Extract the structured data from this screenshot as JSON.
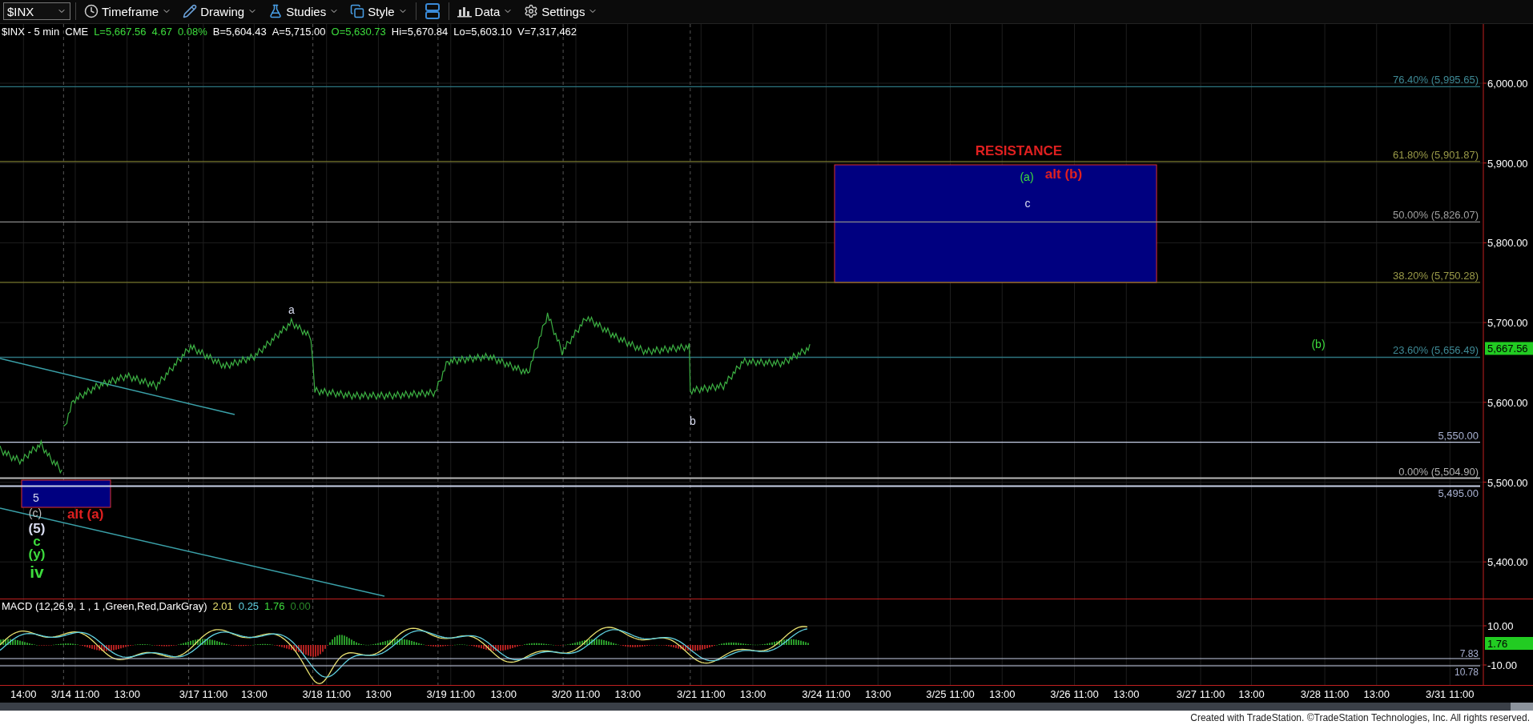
{
  "toolbar": {
    "symbol": "$INX",
    "menus": [
      {
        "kind": "timeframe",
        "label": "Timeframe"
      },
      {
        "kind": "drawing",
        "label": "Drawing"
      },
      {
        "kind": "studies",
        "label": "Studies"
      },
      {
        "kind": "style",
        "label": "Style"
      },
      {
        "kind": "layout"
      },
      {
        "kind": "data",
        "label": "Data"
      },
      {
        "kind": "settings",
        "label": "Settings"
      }
    ]
  },
  "quote": {
    "title": "$INX - 5 min",
    "exchange": "CME",
    "fields": [
      {
        "text": "L=5,667.56",
        "color": "#3ddc3d"
      },
      {
        "text": "4.67",
        "color": "#3ddc3d"
      },
      {
        "text": "0.08%",
        "color": "#3ddc3d"
      },
      {
        "text": "B=5,604.43",
        "color": "#ffffff"
      },
      {
        "text": "A=5,715.00",
        "color": "#ffffff"
      },
      {
        "text": "O=5,630.73",
        "color": "#3ddc3d"
      },
      {
        "text": "Hi=5,670.84",
        "color": "#ffffff"
      },
      {
        "text": "Lo=5,603.10",
        "color": "#ffffff"
      },
      {
        "text": "V=7,317,462",
        "color": "#ffffff"
      }
    ]
  },
  "price_axis": {
    "ticks": [
      "6,000.00",
      "5,900.00",
      "5,800.00",
      "5,700.00",
      "5,600.00",
      "5,500.00",
      "5,400.00"
    ],
    "last_price": "5,667.56"
  },
  "fib_levels": [
    {
      "label": "76.40% (5,995.65)"
    },
    {
      "label": "61.80% (5,901.87)"
    },
    {
      "label": "50.00% (5,826.07)"
    },
    {
      "label": "38.20% (5,750.28)"
    },
    {
      "label": "23.60% (5,656.49)"
    },
    {
      "label": "0.00% (5,504.90)"
    }
  ],
  "price_lines": [
    {
      "label": "5,550.00"
    },
    {
      "label": "5,495.00"
    }
  ],
  "annotations": [
    {
      "text": "RESISTANCE",
      "kind": "bold",
      "color": "#e02020"
    },
    {
      "text": "(a)",
      "kind": "small",
      "color": "#3ddc3d"
    },
    {
      "text": "alt (b)",
      "kind": "bold",
      "color": "#e02020"
    },
    {
      "text": "c",
      "kind": "small",
      "color": "#d8dcf0"
    },
    {
      "text": "a",
      "kind": "small",
      "color": "#d8dcf0"
    },
    {
      "text": "b",
      "kind": "small",
      "color": "#d8dcf0"
    },
    {
      "text": "(b)",
      "kind": "small",
      "color": "#3ddc3d"
    },
    {
      "text": "5",
      "kind": "small",
      "color": "#d8dcf0"
    },
    {
      "text": "(c)",
      "kind": "small",
      "color": "#c0c0c0"
    },
    {
      "text": "alt (a)",
      "kind": "bold",
      "color": "#e02020"
    },
    {
      "text": "(5)",
      "kind": "bold",
      "color": "#d8dcf0"
    },
    {
      "text": "c",
      "kind": "bold",
      "color": "#3ddc3d"
    },
    {
      "text": "(y)",
      "kind": "bold",
      "color": "#3ddc3d"
    },
    {
      "text": "iv",
      "kind": "big",
      "color": "#3ddc3d"
    }
  ],
  "macd": {
    "label": "MACD (12,26,9, 1 , 1 ,Green,Red,DarkGray)",
    "values": [
      {
        "text": "2.01",
        "color": "#e8e070"
      },
      {
        "text": "0.25",
        "color": "#60d0e0"
      },
      {
        "text": "1.76",
        "color": "#3ddc3d"
      },
      {
        "text": "0.00",
        "color": "#2a8a2a"
      }
    ],
    "axis": [
      "10.00",
      "-10.00"
    ],
    "last_value": "1.76",
    "lines": [
      {
        "label": "7.83"
      },
      {
        "label": "10.78"
      }
    ]
  },
  "time_axis": [
    "14:00",
    "3/14 11:00",
    "13:00",
    "3/17 11:00",
    "13:00",
    "3/18 11:00",
    "13:00",
    "3/19 11:00",
    "13:00",
    "3/20 11:00",
    "13:00",
    "3/21 11:00",
    "13:00",
    "3/24 11:00",
    "13:00",
    "3/25 11:00",
    "13:00",
    "3/26 11:00",
    "13:00",
    "3/27 11:00",
    "13:00",
    "3/28 11:00",
    "13:00",
    "3/31 11:00"
  ],
  "footer": "Created with TradeStation. ©TradeStation Technologies, Inc. All rights reserved."
}
